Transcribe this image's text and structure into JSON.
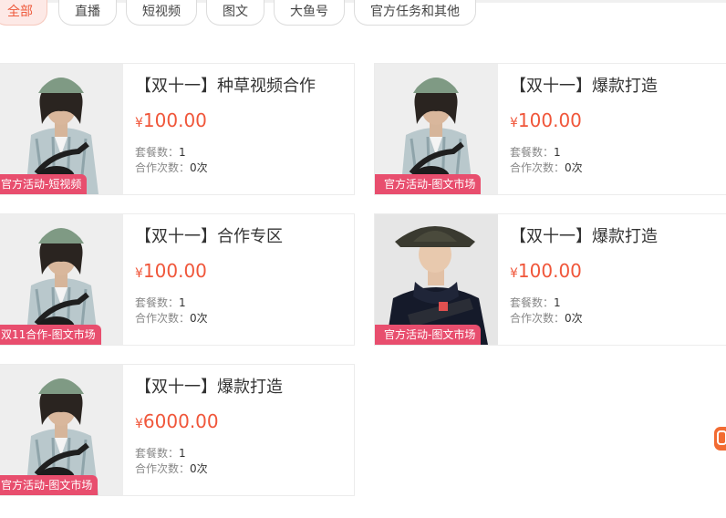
{
  "tabs": [
    {
      "label": "全部",
      "active": true
    },
    {
      "label": "直播",
      "active": false
    },
    {
      "label": "短视频",
      "active": false
    },
    {
      "label": "图文",
      "active": false
    },
    {
      "label": "大鱼号",
      "active": false
    },
    {
      "label": "官方任务和其他",
      "active": false
    }
  ],
  "labels": {
    "currency": "¥",
    "package_count_label": "套餐数：",
    "cooperation_count_label": "合作次数："
  },
  "products": [
    {
      "title": "【双十一】种草视频合作",
      "price": "100.00",
      "package_count": "1",
      "cooperation_count": "0次",
      "badge": "官方活动-短视频",
      "image": "model-green-hat"
    },
    {
      "title": "【双十一】爆款打造",
      "price": "100.00",
      "package_count": "1",
      "cooperation_count": "0次",
      "badge": "官方活动-图文市场",
      "image": "model-green-hat"
    },
    {
      "title": "【双十一】合作专区",
      "price": "100.00",
      "package_count": "1",
      "cooperation_count": "0次",
      "badge": "双11合作-图文市场",
      "image": "model-green-hat"
    },
    {
      "title": "【双十一】爆款打造",
      "price": "100.00",
      "package_count": "1",
      "cooperation_count": "0次",
      "badge": "官方活动-图文市场",
      "image": "model-navy-hoodie"
    },
    {
      "title": "【双十一】爆款打造",
      "price": "6000.00",
      "package_count": "1",
      "cooperation_count": "0次",
      "badge": "官方活动-图文市场",
      "image": "model-green-hat"
    }
  ],
  "colors": {
    "accent": "#f0563a",
    "badge": "#e84e6e",
    "active_tab_bg": "#fde9e6",
    "float_widget": "#f26b32"
  }
}
